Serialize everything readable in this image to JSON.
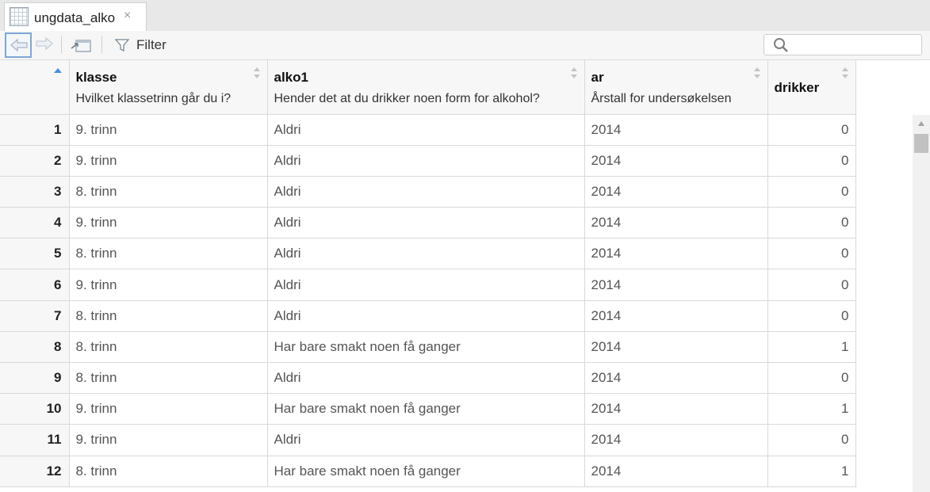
{
  "tab": {
    "title": "ungdata_alko",
    "close": "×"
  },
  "toolbar": {
    "filter_label": "Filter",
    "search_placeholder": ""
  },
  "columns": [
    {
      "name": "klasse",
      "label": "Hvilket klassetrinn går du i?"
    },
    {
      "name": "alko1",
      "label": "Hender det at du drikker noen form for alkohol?"
    },
    {
      "name": "ar",
      "label": "Årstall for undersøkelsen"
    },
    {
      "name": "drikker",
      "label": ""
    }
  ],
  "rows": [
    {
      "n": "1",
      "klasse": "9. trinn",
      "alko1": "Aldri",
      "ar": "2014",
      "drikker": "0"
    },
    {
      "n": "2",
      "klasse": "9. trinn",
      "alko1": "Aldri",
      "ar": "2014",
      "drikker": "0"
    },
    {
      "n": "3",
      "klasse": "8. trinn",
      "alko1": "Aldri",
      "ar": "2014",
      "drikker": "0"
    },
    {
      "n": "4",
      "klasse": "9. trinn",
      "alko1": "Aldri",
      "ar": "2014",
      "drikker": "0"
    },
    {
      "n": "5",
      "klasse": "8. trinn",
      "alko1": "Aldri",
      "ar": "2014",
      "drikker": "0"
    },
    {
      "n": "6",
      "klasse": "9. trinn",
      "alko1": "Aldri",
      "ar": "2014",
      "drikker": "0"
    },
    {
      "n": "7",
      "klasse": "8. trinn",
      "alko1": "Aldri",
      "ar": "2014",
      "drikker": "0"
    },
    {
      "n": "8",
      "klasse": "8. trinn",
      "alko1": "Har bare smakt noen få ganger",
      "ar": "2014",
      "drikker": "1"
    },
    {
      "n": "9",
      "klasse": "8. trinn",
      "alko1": "Aldri",
      "ar": "2014",
      "drikker": "0"
    },
    {
      "n": "10",
      "klasse": "9. trinn",
      "alko1": "Har bare smakt noen få ganger",
      "ar": "2014",
      "drikker": "1"
    },
    {
      "n": "11",
      "klasse": "9. trinn",
      "alko1": "Aldri",
      "ar": "2014",
      "drikker": "0"
    },
    {
      "n": "12",
      "klasse": "8. trinn",
      "alko1": "Har bare smakt noen få ganger",
      "ar": "2014",
      "drikker": "1"
    }
  ],
  "icons": {
    "tab": "table-grid-icon",
    "close": "close-icon",
    "back": "arrow-left-icon",
    "forward": "arrow-right-icon",
    "popout": "popout-window-icon",
    "filter": "filter-funnel-icon",
    "search": "search-icon",
    "sort": "sort-arrows-icon"
  },
  "colors": {
    "accent": "#4a90d9",
    "header_bg": "#f7f7f7",
    "border": "#d9d9d9"
  }
}
